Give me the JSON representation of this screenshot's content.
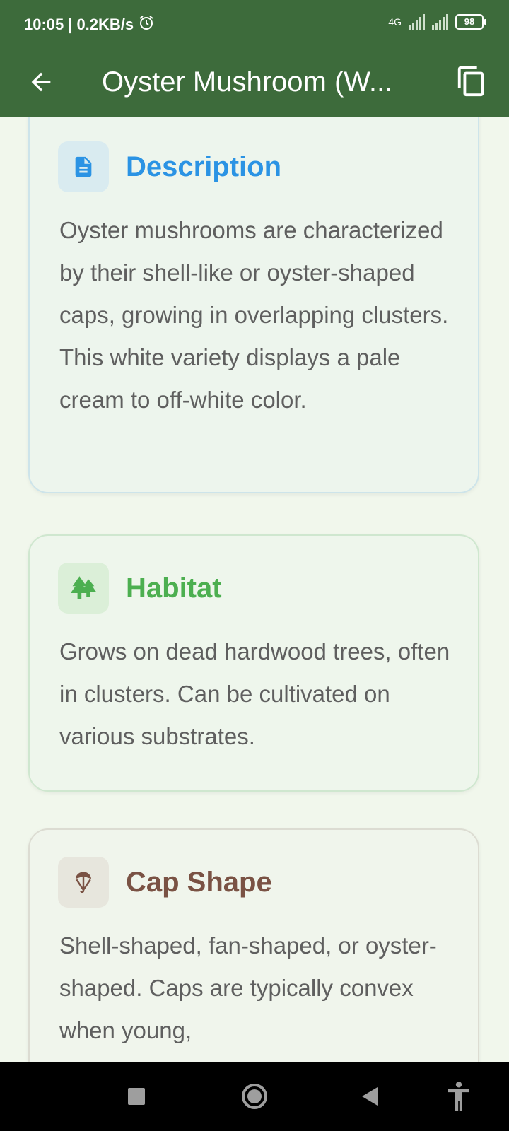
{
  "status": {
    "time": "10:05",
    "speed": "0.2KB/s",
    "network": "4G",
    "battery": "98"
  },
  "app_bar": {
    "title": "Oyster Mushroom (W..."
  },
  "cards": {
    "description": {
      "title": "Description",
      "text": "Oyster mushrooms are characterized by their shell-like or oyster-shaped caps, growing in overlapping clusters.  This white variety displays a pale cream to off-white color.",
      "accent": "#2b93e4",
      "icon": "document-icon"
    },
    "habitat": {
      "title": "Habitat",
      "text": "Grows on dead hardwood trees, often in clusters.  Can be cultivated on various substrates.",
      "accent": "#4caf50",
      "icon": "trees-icon"
    },
    "cap_shape": {
      "title": "Cap Shape",
      "text": "Shell-shaped, fan-shaped, or oyster-shaped.  Caps are typically convex when young,",
      "accent": "#7a5244",
      "icon": "umbrella-icon"
    }
  },
  "colors": {
    "app_bar": "#3d6b3b",
    "background": "#f1f7ec"
  }
}
